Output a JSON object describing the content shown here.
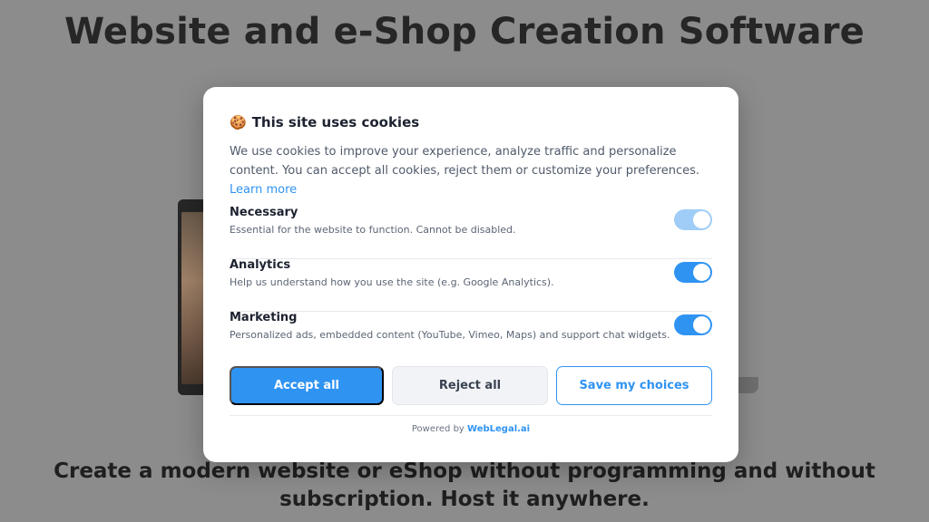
{
  "page": {
    "title": "Website and e-Shop Creation Software",
    "subtitle_line1": "Create a modern website or eShop without programming and without",
    "subtitle_line2": "subscription. Host it anywhere."
  },
  "consent": {
    "icon": "cookie-icon",
    "title": "This site uses cookies",
    "description": "We use cookies to improve your experience, analyze traffic and personalize content. You can accept all cookies, reject them or customize your preferences.",
    "learn_more": "Learn more",
    "categories": [
      {
        "name": "Necessary",
        "description": "Essential for the website to function. Cannot be disabled.",
        "enabled": true,
        "disabled": true
      },
      {
        "name": "Analytics",
        "description": "Help us understand how you use the site (e.g. Google Analytics).",
        "enabled": true,
        "disabled": false
      },
      {
        "name": "Marketing",
        "description": "Personalized ads, embedded content (YouTube, Vimeo, Maps) and support chat widgets.",
        "enabled": true,
        "disabled": false
      }
    ],
    "buttons": {
      "accept_all": "Accept all",
      "reject_all": "Reject all",
      "save": "Save my choices"
    },
    "powered_by_prefix": "Powered by",
    "powered_by_brand": "WebLegal.ai"
  },
  "colors": {
    "accent": "#2f93f2",
    "overlay": "#8c8c8c"
  }
}
